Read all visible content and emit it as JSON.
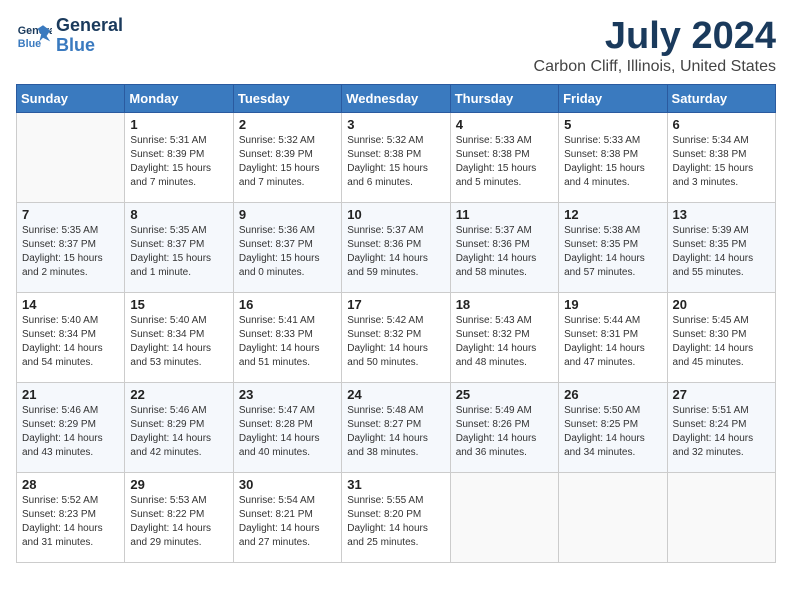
{
  "logo": {
    "line1": "General",
    "line2": "Blue"
  },
  "title": "July 2024",
  "location": "Carbon Cliff, Illinois, United States",
  "days_of_week": [
    "Sunday",
    "Monday",
    "Tuesday",
    "Wednesday",
    "Thursday",
    "Friday",
    "Saturday"
  ],
  "weeks": [
    [
      {
        "day": "",
        "info": ""
      },
      {
        "day": "1",
        "info": "Sunrise: 5:31 AM\nSunset: 8:39 PM\nDaylight: 15 hours\nand 7 minutes."
      },
      {
        "day": "2",
        "info": "Sunrise: 5:32 AM\nSunset: 8:39 PM\nDaylight: 15 hours\nand 7 minutes."
      },
      {
        "day": "3",
        "info": "Sunrise: 5:32 AM\nSunset: 8:38 PM\nDaylight: 15 hours\nand 6 minutes."
      },
      {
        "day": "4",
        "info": "Sunrise: 5:33 AM\nSunset: 8:38 PM\nDaylight: 15 hours\nand 5 minutes."
      },
      {
        "day": "5",
        "info": "Sunrise: 5:33 AM\nSunset: 8:38 PM\nDaylight: 15 hours\nand 4 minutes."
      },
      {
        "day": "6",
        "info": "Sunrise: 5:34 AM\nSunset: 8:38 PM\nDaylight: 15 hours\nand 3 minutes."
      }
    ],
    [
      {
        "day": "7",
        "info": "Sunrise: 5:35 AM\nSunset: 8:37 PM\nDaylight: 15 hours\nand 2 minutes."
      },
      {
        "day": "8",
        "info": "Sunrise: 5:35 AM\nSunset: 8:37 PM\nDaylight: 15 hours\nand 1 minute."
      },
      {
        "day": "9",
        "info": "Sunrise: 5:36 AM\nSunset: 8:37 PM\nDaylight: 15 hours\nand 0 minutes."
      },
      {
        "day": "10",
        "info": "Sunrise: 5:37 AM\nSunset: 8:36 PM\nDaylight: 14 hours\nand 59 minutes."
      },
      {
        "day": "11",
        "info": "Sunrise: 5:37 AM\nSunset: 8:36 PM\nDaylight: 14 hours\nand 58 minutes."
      },
      {
        "day": "12",
        "info": "Sunrise: 5:38 AM\nSunset: 8:35 PM\nDaylight: 14 hours\nand 57 minutes."
      },
      {
        "day": "13",
        "info": "Sunrise: 5:39 AM\nSunset: 8:35 PM\nDaylight: 14 hours\nand 55 minutes."
      }
    ],
    [
      {
        "day": "14",
        "info": "Sunrise: 5:40 AM\nSunset: 8:34 PM\nDaylight: 14 hours\nand 54 minutes."
      },
      {
        "day": "15",
        "info": "Sunrise: 5:40 AM\nSunset: 8:34 PM\nDaylight: 14 hours\nand 53 minutes."
      },
      {
        "day": "16",
        "info": "Sunrise: 5:41 AM\nSunset: 8:33 PM\nDaylight: 14 hours\nand 51 minutes."
      },
      {
        "day": "17",
        "info": "Sunrise: 5:42 AM\nSunset: 8:32 PM\nDaylight: 14 hours\nand 50 minutes."
      },
      {
        "day": "18",
        "info": "Sunrise: 5:43 AM\nSunset: 8:32 PM\nDaylight: 14 hours\nand 48 minutes."
      },
      {
        "day": "19",
        "info": "Sunrise: 5:44 AM\nSunset: 8:31 PM\nDaylight: 14 hours\nand 47 minutes."
      },
      {
        "day": "20",
        "info": "Sunrise: 5:45 AM\nSunset: 8:30 PM\nDaylight: 14 hours\nand 45 minutes."
      }
    ],
    [
      {
        "day": "21",
        "info": "Sunrise: 5:46 AM\nSunset: 8:29 PM\nDaylight: 14 hours\nand 43 minutes."
      },
      {
        "day": "22",
        "info": "Sunrise: 5:46 AM\nSunset: 8:29 PM\nDaylight: 14 hours\nand 42 minutes."
      },
      {
        "day": "23",
        "info": "Sunrise: 5:47 AM\nSunset: 8:28 PM\nDaylight: 14 hours\nand 40 minutes."
      },
      {
        "day": "24",
        "info": "Sunrise: 5:48 AM\nSunset: 8:27 PM\nDaylight: 14 hours\nand 38 minutes."
      },
      {
        "day": "25",
        "info": "Sunrise: 5:49 AM\nSunset: 8:26 PM\nDaylight: 14 hours\nand 36 minutes."
      },
      {
        "day": "26",
        "info": "Sunrise: 5:50 AM\nSunset: 8:25 PM\nDaylight: 14 hours\nand 34 minutes."
      },
      {
        "day": "27",
        "info": "Sunrise: 5:51 AM\nSunset: 8:24 PM\nDaylight: 14 hours\nand 32 minutes."
      }
    ],
    [
      {
        "day": "28",
        "info": "Sunrise: 5:52 AM\nSunset: 8:23 PM\nDaylight: 14 hours\nand 31 minutes."
      },
      {
        "day": "29",
        "info": "Sunrise: 5:53 AM\nSunset: 8:22 PM\nDaylight: 14 hours\nand 29 minutes."
      },
      {
        "day": "30",
        "info": "Sunrise: 5:54 AM\nSunset: 8:21 PM\nDaylight: 14 hours\nand 27 minutes."
      },
      {
        "day": "31",
        "info": "Sunrise: 5:55 AM\nSunset: 8:20 PM\nDaylight: 14 hours\nand 25 minutes."
      },
      {
        "day": "",
        "info": ""
      },
      {
        "day": "",
        "info": ""
      },
      {
        "day": "",
        "info": ""
      }
    ]
  ]
}
